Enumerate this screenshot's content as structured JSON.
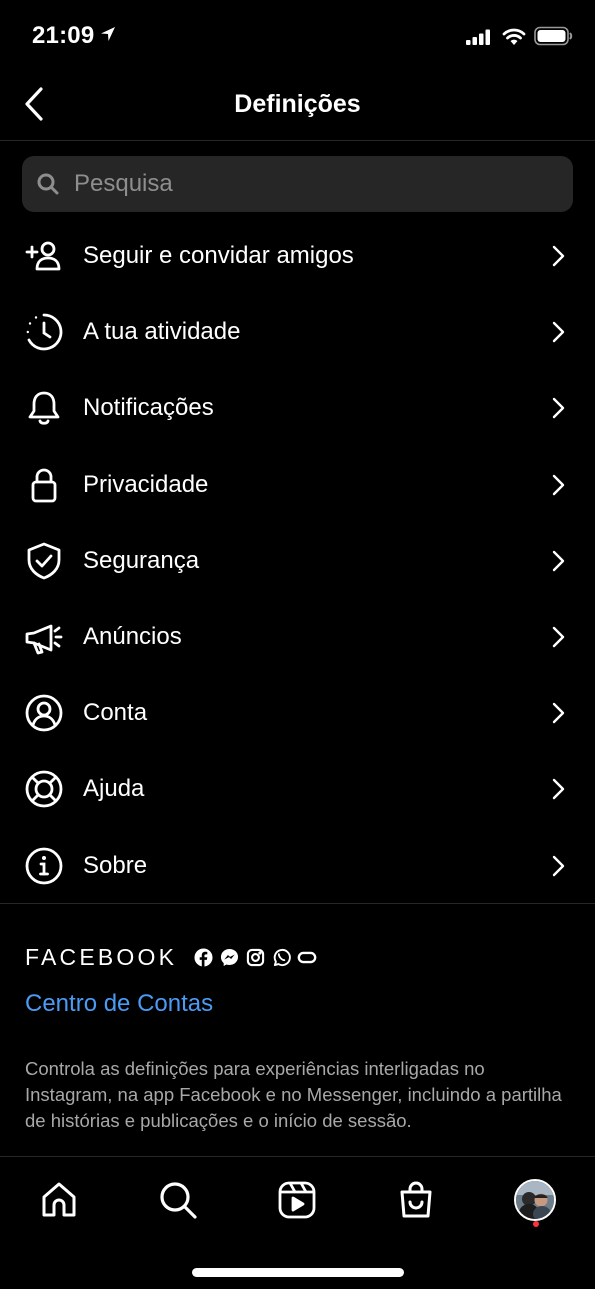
{
  "status_bar": {
    "time": "21:09",
    "icons": [
      "location-arrow-icon",
      "signal-icon",
      "wifi-icon",
      "battery-icon"
    ]
  },
  "header": {
    "title": "Definições",
    "back_icon": "chevron-left-icon"
  },
  "search": {
    "placeholder": "Pesquisa"
  },
  "settings": {
    "items": [
      {
        "label": "Seguir e convidar amigos",
        "icon": "add-person-icon"
      },
      {
        "label": "A tua atividade",
        "icon": "activity-clock-icon"
      },
      {
        "label": "Notificações",
        "icon": "bell-icon"
      },
      {
        "label": "Privacidade",
        "icon": "lock-icon"
      },
      {
        "label": "Segurança",
        "icon": "shield-check-icon"
      },
      {
        "label": "Anúncios",
        "icon": "megaphone-icon"
      },
      {
        "label": "Conta",
        "icon": "account-circle-icon"
      },
      {
        "label": "Ajuda",
        "icon": "lifebuoy-icon"
      },
      {
        "label": "Sobre",
        "icon": "info-icon"
      }
    ]
  },
  "facebook": {
    "wordmark": "FACEBOOK",
    "icons": [
      "facebook-icon",
      "messenger-icon",
      "instagram-icon",
      "whatsapp-icon",
      "portal-icon"
    ],
    "accounts_link": "Centro de Contas",
    "description": "Controla as definições para experiências interligadas no Instagram, na app Facebook e no Messenger, incluindo a partilha de histórias e publicações e o início de sessão."
  },
  "tab_bar": {
    "tabs": [
      "home-icon",
      "search-icon",
      "reels-icon",
      "shop-icon",
      "profile-avatar"
    ],
    "profile_notification": true
  },
  "colors": {
    "background": "#000000",
    "link": "#4a9bf6",
    "secondary_text": "#a8a8a8",
    "search_bg": "#262626",
    "notification_dot": "#ff3040"
  }
}
